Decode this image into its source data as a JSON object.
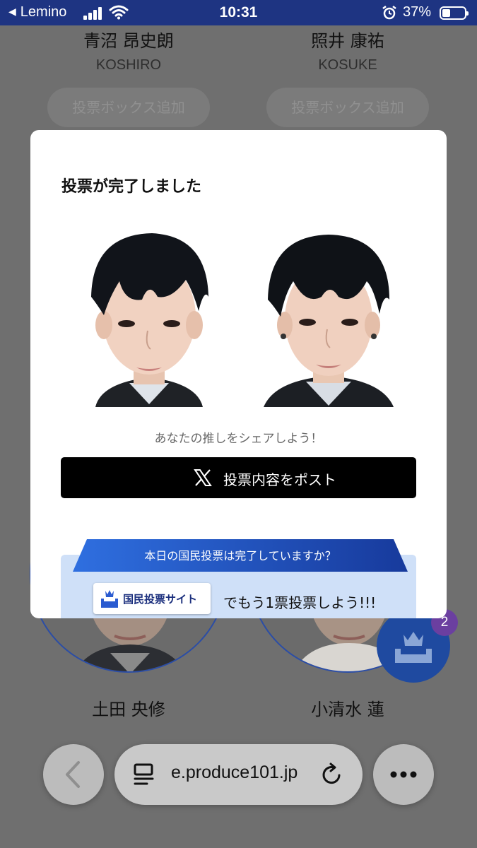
{
  "status_bar": {
    "carrier": "Lemino",
    "time": "10:31",
    "battery": "37%"
  },
  "background": {
    "top_candidates": [
      {
        "name_jp": "青沼 昂史朗",
        "name_en": "KOSHIRO"
      },
      {
        "name_jp": "照井 康祐",
        "name_en": "KOSUKE"
      }
    ],
    "add_box_label": "投票ボックス追加",
    "bottom_candidates": [
      {
        "name_jp": "土田 央修"
      },
      {
        "name_jp": "小清水 蓮"
      }
    ],
    "vote_box_count": "2"
  },
  "modal": {
    "title": "投票が完了しました",
    "share_prompt": "あなたの推しをシェアしよう！",
    "post_button_label": "投票内容をポスト",
    "banner": {
      "ribbon_text": "本日の国民投票は完了していますか？",
      "site_badge_label": "国民投票サイト",
      "cta_text": "でもう1票投票しよう!!!"
    }
  },
  "browser": {
    "url": "e.produce101.jp"
  },
  "colors": {
    "status_bar": "#1e3482",
    "accent_blue": "#1f4aa0",
    "post_button": "#000000",
    "banner_bg": "#cfe0f8"
  },
  "icons": [
    "back-icon",
    "signal-icon",
    "wifi-icon",
    "alarm-icon",
    "battery-icon",
    "x-logo-icon",
    "ballot-box-icon",
    "chevron-left-icon",
    "tabs-icon",
    "reload-icon",
    "more-icon"
  ]
}
